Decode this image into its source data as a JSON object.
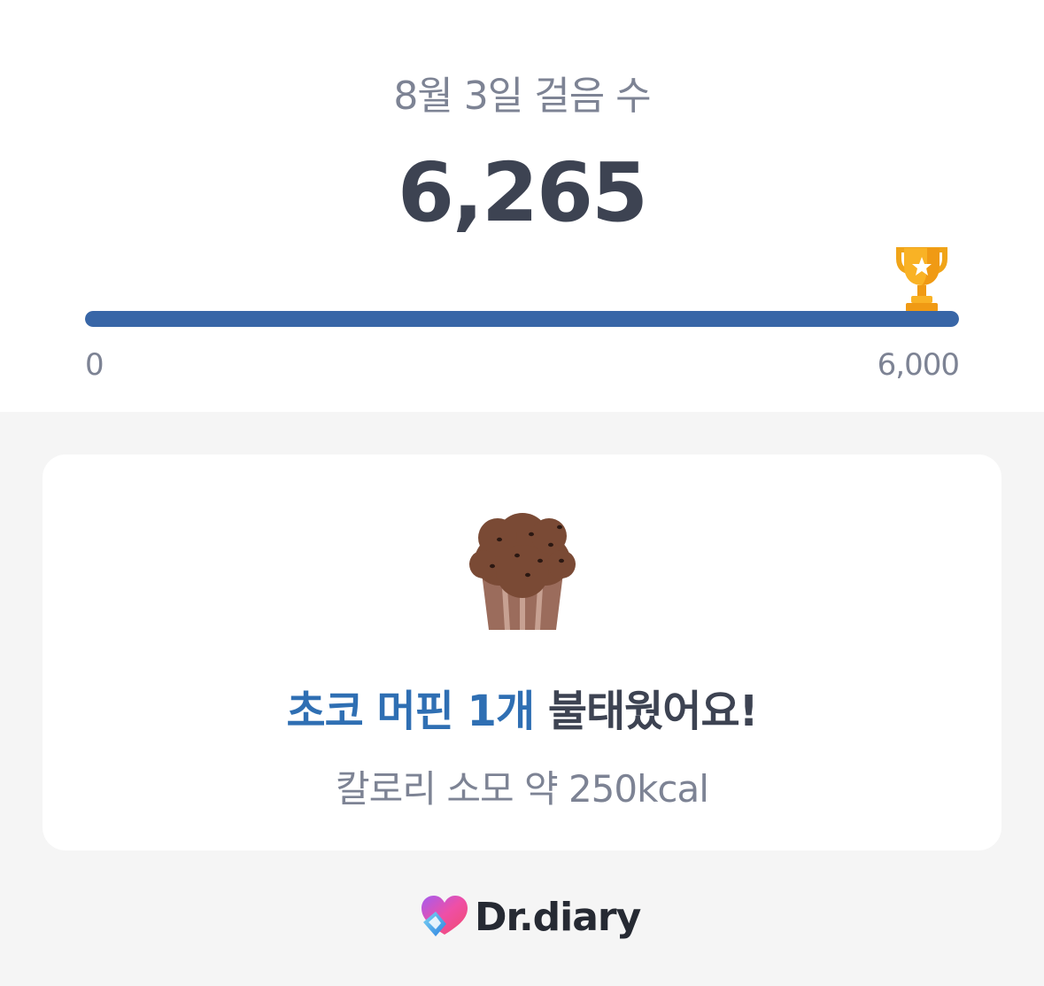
{
  "header": {
    "date_title": "8월 3일 걸음 수",
    "step_count": "6,265"
  },
  "progress": {
    "value": 6265,
    "goal": 6000,
    "fraction": 1.0,
    "min_label": "0",
    "max_label": "6,000",
    "icon": "trophy-icon",
    "bar_color": "#3866a7"
  },
  "card": {
    "icon": "muffin-icon",
    "headline_accent": "초코 머핀 1개",
    "headline_rest": " 불태웠어요!",
    "subline": "칼로리 소모 약 250kcal",
    "accent_color": "#2f6fb3"
  },
  "brand": {
    "name": "Dr.diary",
    "icon": "dr-diary-logo-icon"
  }
}
